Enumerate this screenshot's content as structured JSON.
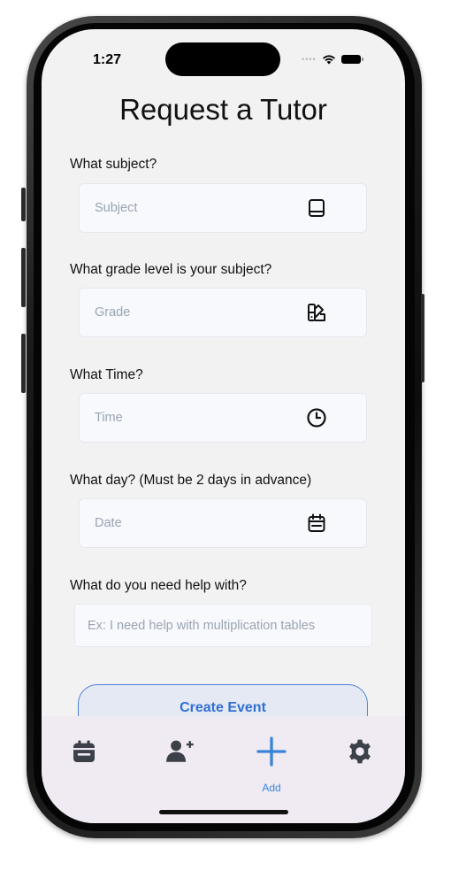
{
  "status_bar": {
    "time": "1:27"
  },
  "page": {
    "title": "Request a Tutor"
  },
  "form": {
    "subject": {
      "question": "What subject?",
      "placeholder": "Subject"
    },
    "grade": {
      "question": "What grade level is your subject?",
      "placeholder": "Grade"
    },
    "time": {
      "question": "What Time?",
      "placeholder": "Time"
    },
    "date": {
      "question": "What day? (Must be 2 days in advance)",
      "placeholder": "Date"
    },
    "help": {
      "question": "What do you need help with?",
      "placeholder": "Ex: I need help with multiplication tables"
    },
    "submit_label": "Create Event"
  },
  "tabbar": {
    "items": [
      {
        "icon": "calendar-icon"
      },
      {
        "icon": "add-person-icon"
      },
      {
        "icon": "plus-icon",
        "label": "Add",
        "active": true
      },
      {
        "icon": "gear-icon"
      }
    ]
  },
  "colors": {
    "accent": "#2f6fd6",
    "tabbar_bg": "#f0ebf3",
    "field_bg": "#f8f9fc",
    "placeholder": "#9aa3b2"
  }
}
